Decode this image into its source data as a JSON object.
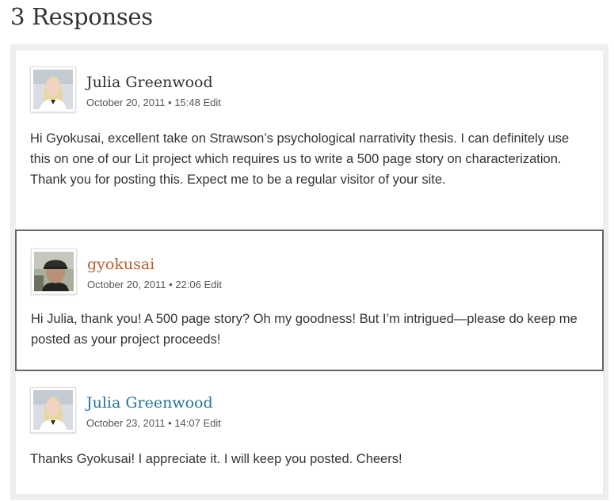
{
  "title": "3 Responses",
  "comments": [
    {
      "author": "Julia Greenwood",
      "date": "October 20, 2011",
      "separator": "•",
      "time": "15:48",
      "edit": "Edit",
      "text": "Hi Gyokusai, excellent take on Strawson’s psychological narrativity thesis. I can definitely use this on one of our Lit project which requires us to write a 500 page story on characterization. Thank you for posting this. Expect me to be a regular visitor of your site.",
      "author_color": "#333333"
    },
    {
      "author": "gyokusai",
      "date": "October 20, 2011",
      "separator": "•",
      "time": "22:06",
      "edit": "Edit",
      "text": "Hi Julia, thank you! A 500 page story? Oh my goodness! But I’m intrigued—please do keep me posted as your project proceeds!",
      "author_color": "#b85f2f"
    },
    {
      "author": "Julia Greenwood",
      "date": "October 23, 2011",
      "separator": "•",
      "time": "14:07",
      "edit": "Edit",
      "text": "Thanks Gyokusai! I appreciate it. I will keep you posted. Cheers!",
      "author_color": "#21759b"
    }
  ]
}
